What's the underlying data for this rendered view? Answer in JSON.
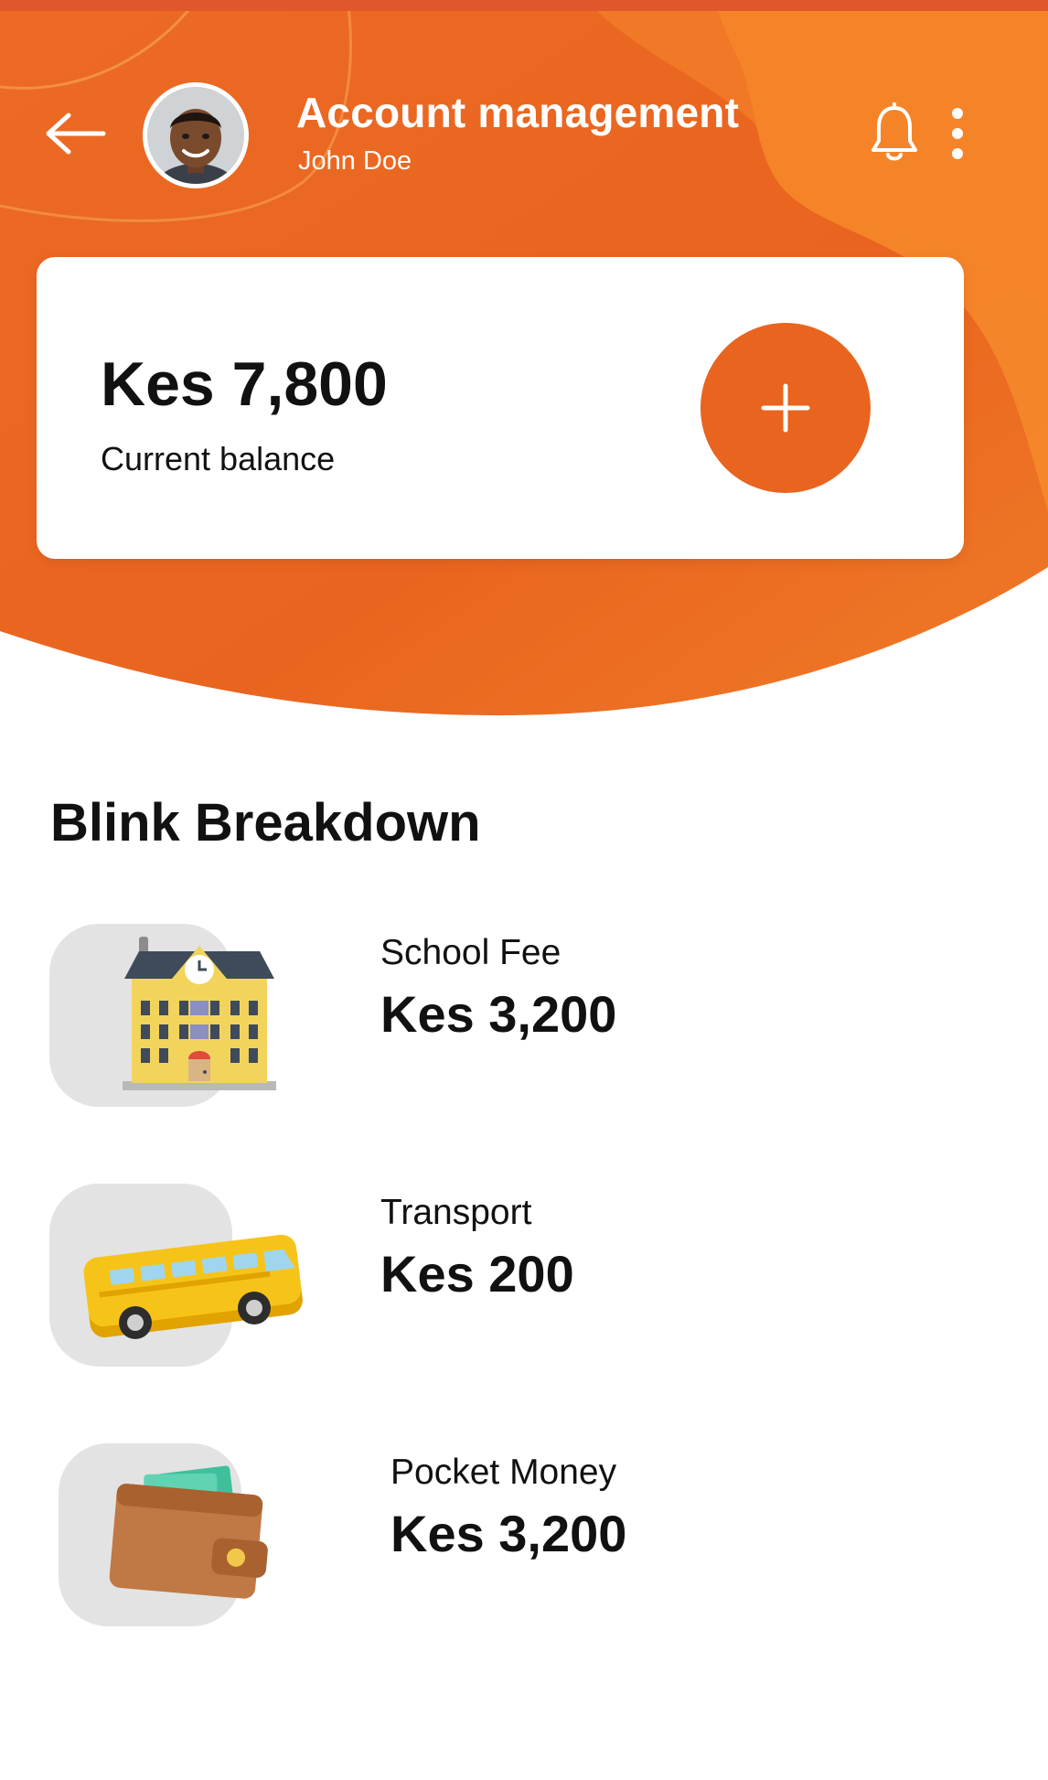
{
  "header": {
    "title": "Account management",
    "user_name": "John Doe"
  },
  "balance": {
    "amount": "Kes 7,800",
    "label": "Current balance"
  },
  "breakdown": {
    "title": "Blink Breakdown",
    "items": [
      {
        "label": "School Fee",
        "amount": "Kes 3,200",
        "icon": "school-icon"
      },
      {
        "label": "Transport",
        "amount": "Kes 200",
        "icon": "bus-icon"
      },
      {
        "label": "Pocket Money",
        "amount": "Kes 3,200",
        "icon": "wallet-icon"
      }
    ]
  },
  "icons": {
    "back": "arrow-left-icon",
    "notifications": "bell-icon",
    "more": "more-vertical-icon",
    "add": "plus-icon"
  },
  "colors": {
    "brand_orange": "#e8641f",
    "header_light_orange": "#f7892b",
    "tile_gray": "#e3e3e3",
    "text_dark": "#111111"
  }
}
